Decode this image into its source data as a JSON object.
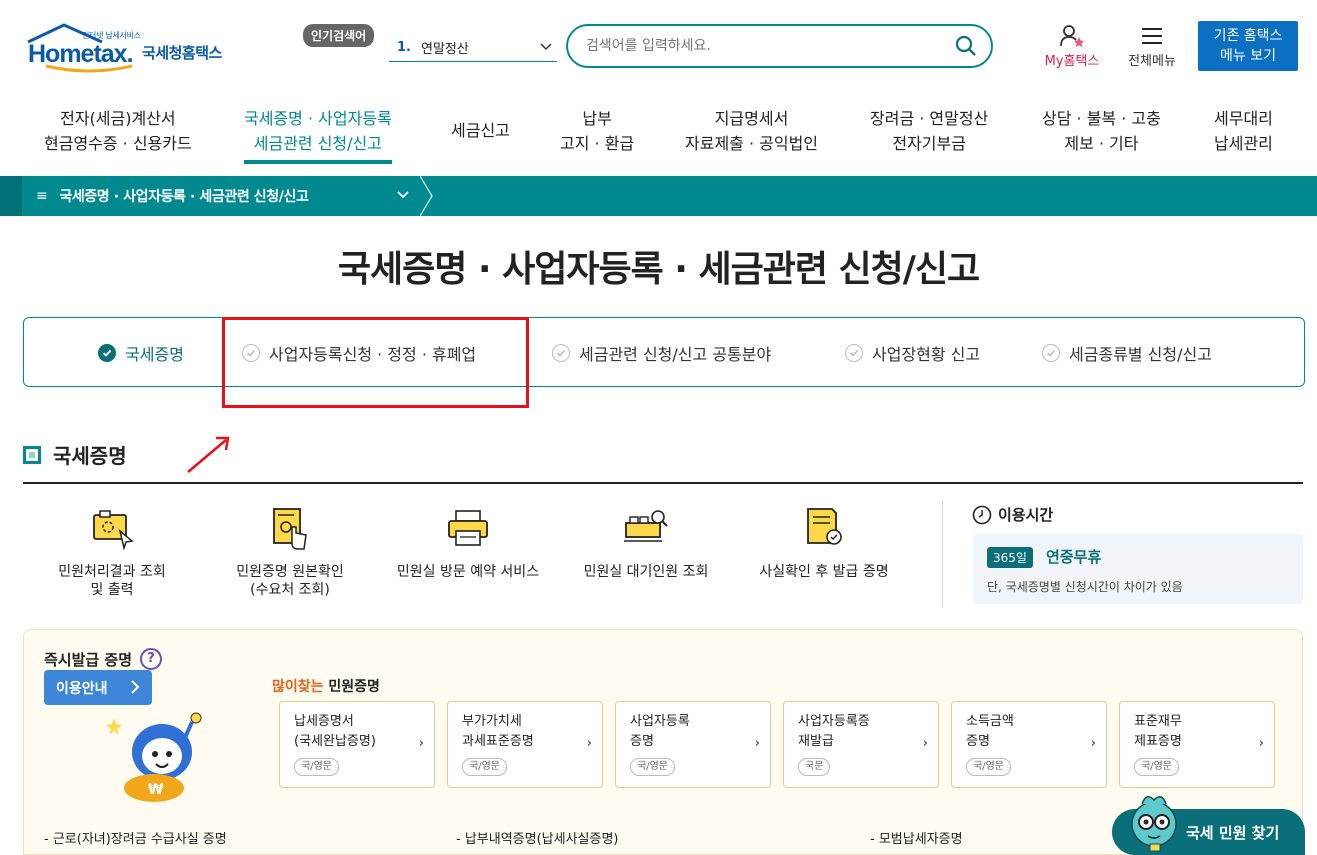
{
  "header": {
    "logo_small": "인터넷 납세서비스",
    "logo_main": "Hometax.",
    "logo_kr": "국세청홈택스",
    "popular_badge": "인기검색어",
    "popular_num": "1.",
    "popular_term": "연말정산",
    "search_placeholder": "검색어를 입력하세요.",
    "my_hometax": "My홈택스",
    "all_menu": "전체메뉴",
    "old_menu_line1": "기존 홈택스",
    "old_menu_line2": "메뉴 보기"
  },
  "gnb": [
    {
      "line1": "전자(세금)계산서",
      "line2": "현금영수증 · 신용카드"
    },
    {
      "line1": "국세증명 · 사업자등록",
      "line2": "세금관련 신청/신고"
    },
    {
      "line1": "세금신고",
      "line2": ""
    },
    {
      "line1": "납부",
      "line2": "고지 · 환급"
    },
    {
      "line1": "지급명세서",
      "line2": "자료제출 · 공익법인"
    },
    {
      "line1": "장려금 · 연말정산",
      "line2": "전자기부금"
    },
    {
      "line1": "상담 · 불복 · 고충",
      "line2": "제보 · 기타"
    },
    {
      "line1": "세무대리",
      "line2": "납세관리"
    }
  ],
  "breadcrumb": {
    "label": "국세증명 · 사업자등록 · 세금관련 신청/신고"
  },
  "page_title": "국세증명 · 사업자등록 · 세금관련 신청/신고",
  "tabs": [
    {
      "label": "국세증명",
      "active": true
    },
    {
      "label": "사업자등록신청 · 정정 · 휴폐업",
      "active": false
    },
    {
      "label": "세금관련 신청/신고 공통분야",
      "active": false
    },
    {
      "label": "사업장현황 신고",
      "active": false
    },
    {
      "label": "세금종류별 신청/신고",
      "active": false
    }
  ],
  "section": {
    "title": "국세증명",
    "services": [
      {
        "line1": "민원처리결과 조회",
        "line2": "및 출력",
        "icon": "document-monitor-icon"
      },
      {
        "line1": "민원증명 원본확인",
        "line2": "(수요처 조회)",
        "icon": "certificate-touch-icon"
      },
      {
        "line1": "민원실 방문 예약 서비스",
        "line2": "",
        "icon": "printer-icon"
      },
      {
        "line1": "민원실 대기인원 조회",
        "line2": "",
        "icon": "queue-search-icon"
      },
      {
        "line1": "사실확인 후 발급 증명",
        "line2": "",
        "icon": "verified-document-icon"
      }
    ],
    "usetime": {
      "label": "이용시간",
      "days": "365일",
      "open": "연중무휴",
      "note": "단, 국세증명별 신청시간이 차이가 있음"
    }
  },
  "instant": {
    "title": "즉시발급 증명",
    "help": "?",
    "guide_button": "이용안내",
    "many_hot": "많이찾는",
    "many_rest": " 민원증명",
    "cards": [
      {
        "line1": "납세증명서",
        "line2": "(국세완납증명)",
        "lang": "국/영문"
      },
      {
        "line1": "부가가치세",
        "line2": "과세표준증명",
        "lang": "국/영문"
      },
      {
        "line1": "사업자등록",
        "line2": "증명",
        "lang": "국/영문"
      },
      {
        "line1": "사업자등록증",
        "line2": "재발급",
        "lang": "국문"
      },
      {
        "line1": "소득금액",
        "line2": "증명",
        "lang": "국/영문"
      },
      {
        "line1": "표준재무",
        "line2": "제표증명",
        "lang": "국/영문"
      }
    ],
    "bottom": [
      "- 근로(자녀)장려금 수급사실 증명",
      "- 납부내역증명(납세사실증명)",
      "- 모범납세자증명"
    ]
  },
  "find_button": "국세 민원 찾기",
  "colors": {
    "teal": "#008a8f",
    "blue": "#0b6fc2",
    "highlight": "#e8101a"
  }
}
